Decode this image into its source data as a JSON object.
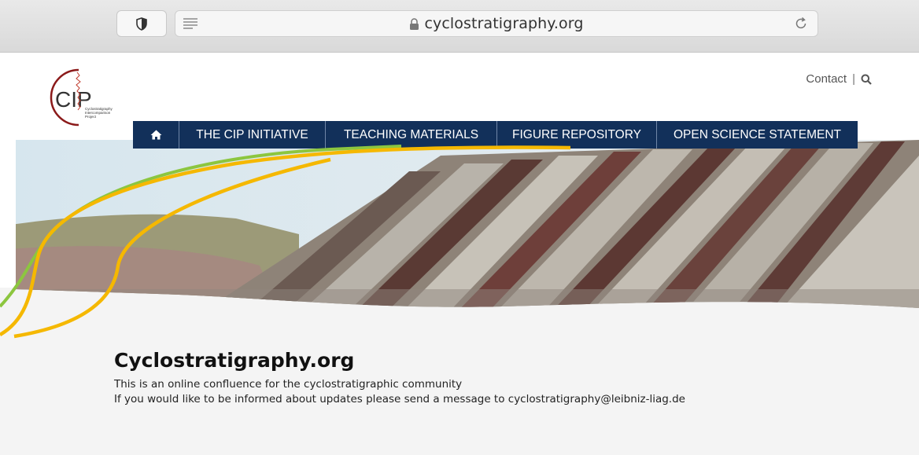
{
  "browser": {
    "url": "cyclostratigraphy.org"
  },
  "header": {
    "logo_text": "CIP",
    "logo_caption": "Cyclostratigraphy Intercomparison Project",
    "contact_label": "Contact",
    "separator": "|"
  },
  "nav": {
    "items": [
      {
        "label": "THE CIP INITIATIVE"
      },
      {
        "label": "TEACHING MATERIALS"
      },
      {
        "label": "FIGURE REPOSITORY"
      },
      {
        "label": "OPEN SCIENCE STATEMENT"
      }
    ]
  },
  "main": {
    "title": "Cyclostratigraphy.org",
    "line1": "This is an online confluence for the cyclostratigraphic community",
    "line2": "If you would like to be informed about updates please send a message to cyclostratigraphy@leibniz-liag.de"
  },
  "colors": {
    "nav_bg": "#12305a",
    "logo_red": "#8b1a1a",
    "curve_green": "#8cc63f",
    "curve_orange": "#f5b800",
    "content_bg": "#f4f4f4"
  }
}
